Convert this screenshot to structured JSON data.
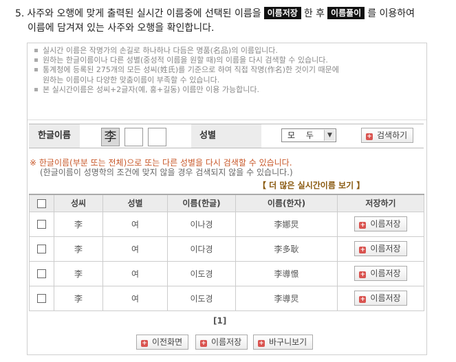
{
  "step": {
    "number": "5.",
    "text_a": "사주와 오행에 맞게 출력된 실시간 이름중에 선택된 이름을",
    "tag1": "이름저장",
    "text_b": "한 후",
    "tag2": "이름풀이",
    "text_c": "를 이용하여",
    "line2": "이름에 담겨져 있는 사주와 오행을 확인합니다."
  },
  "notes": [
    "실시간 이름은 작명가의 손길로 하나하나 다듬은 명품(名品)의 이름입니다.",
    "원하는 한글이름이나 다른 성별(중성적 이름을 원할 때)의 이름을 다시 검색할 수 있습니다.",
    "통계청에 등록된 275개의 모든 성씨(姓氏)를 기준으로 하여 직접 작명(作名)한 것이기 때문에",
    "원하는 이름이나 다양한 맞춤이름이 부족할 수 있습니다.",
    "본 실시간이름은 성씨+2글자(예, 홍+길동) 이름만 이용 가능합니다."
  ],
  "search": {
    "hangul_label": "한글이름",
    "surname_char": "李",
    "gender_label": "성별",
    "gender_value": "모 두",
    "search_button": "검색하기"
  },
  "warnings": {
    "line1": "※ 한글이름(부분 또는 전체)으로 또는 다른 성별을 다시 검색할 수 있습니다.",
    "line2": "(한글이름이 성명학의 조건에 맞지 않을 경우 검색되지 않을 수 있습니다.)"
  },
  "more_link": "【 더 많은 실시간이름 보기 】",
  "table": {
    "headers": [
      "성씨",
      "성별",
      "이름(한글)",
      "이름(한자)",
      "저장하기"
    ],
    "rows": [
      {
        "surname": "李",
        "gender": "여",
        "hangul": "이나경",
        "hanja": "李娜炅",
        "save": "이름저장"
      },
      {
        "surname": "李",
        "gender": "여",
        "hangul": "이다경",
        "hanja": "李多耿",
        "save": "이름저장"
      },
      {
        "surname": "李",
        "gender": "여",
        "hangul": "이도경",
        "hanja": "李導憬",
        "save": "이름저장"
      },
      {
        "surname": "李",
        "gender": "여",
        "hangul": "이도경",
        "hanja": "李導炅",
        "save": "이름저장"
      }
    ]
  },
  "pager": "[1]",
  "bottom": {
    "prev_button": "이전화면",
    "save_button": "이름저장",
    "cart_button": "바구니보기"
  },
  "colors": {
    "warning": "#c8582a",
    "link": "#8a5a10",
    "plus_icon": "#d9534f"
  }
}
